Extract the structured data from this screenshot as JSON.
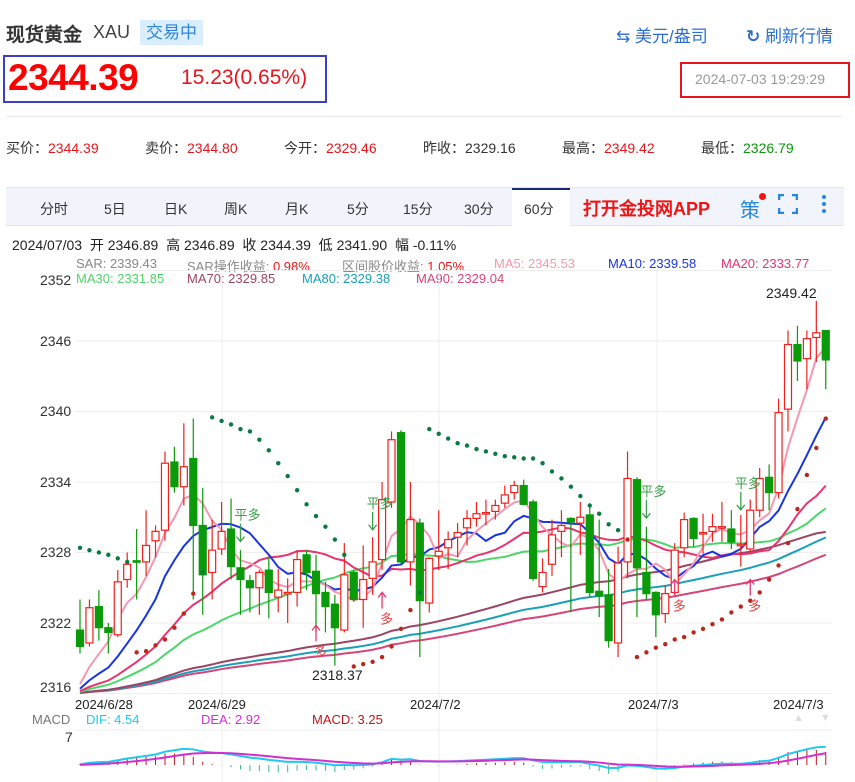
{
  "header": {
    "title": "现货黄金",
    "code": "XAU",
    "status": "交易中",
    "unit_label": "美元/盎司",
    "refresh_label": "刷新行情"
  },
  "quote": {
    "price": "2344.39",
    "change": "15.23(0.65%)",
    "timestamp": "2024-07-03 19:29:29"
  },
  "stats": [
    {
      "label": "买价：",
      "value": "2344.39",
      "color": "#e8161c"
    },
    {
      "label": "卖价：",
      "value": "2344.80",
      "color": "#e8161c"
    },
    {
      "label": "今开：",
      "value": "2329.46",
      "color": "#e8161c"
    },
    {
      "label": "昨收：",
      "value": "2329.16",
      "color": "#333333"
    },
    {
      "label": "最高：",
      "value": "2349.42",
      "color": "#e8161c"
    },
    {
      "label": "最低：",
      "value": "2326.79",
      "color": "#0a9a0a"
    }
  ],
  "tabs": [
    "分时",
    "5日",
    "日K",
    "周K",
    "月K",
    "5分",
    "15分",
    "30分",
    "60分"
  ],
  "active_tab": "60分",
  "app_link": "打开金投网APP",
  "strategy_label": "策",
  "info_line": "2024/07/03  开 2346.89  高 2346.89  收 2344.39  低 2341.90  幅 -0.11%",
  "indicators": {
    "sar": "SAR: 2339.43",
    "sar_profit_label": "SAR操作收益: ",
    "sar_profit": "0.98%",
    "range_profit_label": "区间股价收益: ",
    "range_profit": "1.05%",
    "ma5": "MA5: 2345.53",
    "ma10": "MA10: 2339.58",
    "ma20": "MA20: 2333.77",
    "ma30": "MA30: 2331.85",
    "ma70": "MA70: 2329.85",
    "ma80": "MA80: 2329.38",
    "ma90": "MA90: 2329.04"
  },
  "macd": {
    "label": "MACD",
    "dif": "DIF: 4.54",
    "dea": "DEA: 2.92",
    "macd": "MACD: 3.25",
    "tick": "7"
  },
  "colors": {
    "up": "#f0201c",
    "down": "#0a9a0a",
    "ma5": "#f598b0",
    "ma10": "#1a35e0",
    "ma20": "#e8336e",
    "ma30": "#4cd66a",
    "ma70": "#9b4466",
    "ma80": "#19a0b8",
    "ma90": "#d6457a",
    "dif": "#1ec8f0",
    "dea": "#d030d0"
  },
  "chart_data": {
    "type": "candlestick",
    "y_ticks": [
      "2352",
      "2346",
      "2340",
      "2334",
      "2328",
      "2322",
      "2316"
    ],
    "ylim": [
      2316,
      2352
    ],
    "x_labels": [
      {
        "text": "2024/6/28",
        "i": 0
      },
      {
        "text": "2024/6/29",
        "i": 14
      },
      {
        "text": "2024/7/2",
        "i": 36
      },
      {
        "text": "2024/7/3",
        "i": 59
      },
      {
        "text": "2024/7/3",
        "i": 79
      }
    ],
    "high_label": "2349.42",
    "low_label": "2318.37",
    "ohlc": [
      [
        2321.4,
        2320.0,
        2324.0,
        2319.4
      ],
      [
        2320.3,
        2323.3,
        2324.0,
        2320.0
      ],
      [
        2323.4,
        2321.6,
        2324.8,
        2320.5
      ],
      [
        2321.6,
        2321.2,
        2322.0,
        2319.4
      ],
      [
        2321.0,
        2325.5,
        2326.5,
        2320.8
      ],
      [
        2325.7,
        2327.0,
        2328.0,
        2325.0
      ],
      [
        2327.3,
        2327.2,
        2330.0,
        2324.0
      ],
      [
        2327.2,
        2328.6,
        2331.6,
        2326.0
      ],
      [
        2329.0,
        2329.8,
        2330.3,
        2327.6
      ],
      [
        2329.9,
        2335.6,
        2336.6,
        2329.0
      ],
      [
        2335.7,
        2333.6,
        2337.0,
        2333.1
      ],
      [
        2333.6,
        2335.3,
        2339.0,
        2332.0
      ],
      [
        2336.0,
        2330.3,
        2339.4,
        2324.0
      ],
      [
        2330.3,
        2326.1,
        2333.5,
        2322.7
      ],
      [
        2326.3,
        2328.2,
        2330.8,
        2324.0
      ],
      [
        2328.3,
        2329.8,
        2332.3,
        2327.8
      ],
      [
        2330.0,
        2326.8,
        2332.6,
        2325.7
      ],
      [
        2326.7,
        2325.7,
        2328.2,
        2322.7
      ],
      [
        2325.6,
        2325.0,
        2326.1,
        2322.9
      ],
      [
        2325.0,
        2326.3,
        2326.5,
        2322.7
      ],
      [
        2326.5,
        2324.6,
        2327.6,
        2322.4
      ],
      [
        2324.2,
        2324.8,
        2326.6,
        2322.9
      ],
      [
        2324.5,
        2324.6,
        2325.8,
        2322.0
      ],
      [
        2324.6,
        2327.4,
        2328.2,
        2323.4
      ],
      [
        2327.8,
        2326.3,
        2328.2,
        2324.8
      ],
      [
        2326.4,
        2324.5,
        2327.8,
        2321.2
      ],
      [
        2324.6,
        2323.4,
        2325.5,
        2321.2
      ],
      [
        2323.6,
        2321.6,
        2324.4,
        2318.37
      ],
      [
        2321.4,
        2326.1,
        2328.8,
        2321.2
      ],
      [
        2326.3,
        2324.0,
        2326.5,
        2323.8
      ],
      [
        2324.0,
        2325.7,
        2328.6,
        2321.6
      ],
      [
        2325.8,
        2327.2,
        2329.3,
        2324.4
      ],
      [
        2327.4,
        2332.5,
        2334.0,
        2326.5
      ],
      [
        2332.3,
        2337.6,
        2338.3,
        2331.8
      ],
      [
        2338.2,
        2327.2,
        2338.4,
        2327.0
      ],
      [
        2327.2,
        2330.8,
        2334.0,
        2325.2
      ],
      [
        2330.5,
        2323.9,
        2330.9,
        2319.1
      ],
      [
        2323.7,
        2327.5,
        2327.6,
        2322.9
      ],
      [
        2327.7,
        2328.1,
        2331.6,
        2326.5
      ],
      [
        2328.4,
        2329.1,
        2329.8,
        2326.6
      ],
      [
        2329.3,
        2329.7,
        2330.5,
        2327.6
      ],
      [
        2330.1,
        2330.9,
        2331.6,
        2328.6
      ],
      [
        2330.9,
        2331.3,
        2332.3,
        2330.2
      ],
      [
        2331.3,
        2331.4,
        2332.5,
        2330.3
      ],
      [
        2331.5,
        2332.0,
        2332.5,
        2330.8
      ],
      [
        2332.2,
        2332.9,
        2333.7,
        2331.8
      ],
      [
        2333.1,
        2333.7,
        2334.1,
        2332.5
      ],
      [
        2333.7,
        2332.1,
        2334.2,
        2332.0
      ],
      [
        2332.3,
        2325.8,
        2332.5,
        2325.6
      ],
      [
        2325.1,
        2326.3,
        2327.5,
        2324.6
      ],
      [
        2327.0,
        2329.5,
        2330.8,
        2326.0
      ],
      [
        2329.8,
        2330.3,
        2331.6,
        2327.6
      ],
      [
        2330.9,
        2330.6,
        2331.0,
        2322.9
      ],
      [
        2330.5,
        2331.0,
        2332.3,
        2327.8
      ],
      [
        2331.2,
        2324.6,
        2332.0,
        2324.2
      ],
      [
        2324.7,
        2324.3,
        2330.8,
        2322.5
      ],
      [
        2324.4,
        2320.5,
        2326.6,
        2319.9
      ],
      [
        2320.3,
        2327.1,
        2328.5,
        2319.1
      ],
      [
        2327.2,
        2334.3,
        2336.6,
        2325.8
      ],
      [
        2334.2,
        2326.7,
        2334.4,
        2322.5
      ],
      [
        2326.3,
        2324.5,
        2330.2,
        2324.0
      ],
      [
        2324.6,
        2322.7,
        2324.7,
        2320.8
      ],
      [
        2322.8,
        2324.5,
        2325.2,
        2322.0
      ],
      [
        2324.6,
        2328.2,
        2328.8,
        2324.4
      ],
      [
        2328.4,
        2330.8,
        2331.4,
        2327.6
      ],
      [
        2330.9,
        2329.2,
        2331.0,
        2328.5
      ],
      [
        2329.6,
        2329.7,
        2331.3,
        2327.9
      ],
      [
        2329.8,
        2330.2,
        2331.3,
        2328.9
      ],
      [
        2330.1,
        2330.2,
        2332.3,
        2328.9
      ],
      [
        2330.0,
        2328.9,
        2331.6,
        2328.3
      ],
      [
        2328.6,
        2328.7,
        2331.2,
        2326.8
      ],
      [
        2328.3,
        2331.6,
        2332.5,
        2328.0
      ],
      [
        2331.6,
        2334.3,
        2335.2,
        2331.0
      ],
      [
        2334.4,
        2333.1,
        2335.5,
        2331.6
      ],
      [
        2333.1,
        2339.9,
        2341.1,
        2332.6
      ],
      [
        2340.2,
        2345.7,
        2346.9,
        2338.3
      ],
      [
        2345.7,
        2344.3,
        2347.3,
        2342.6
      ],
      [
        2344.5,
        2346.2,
        2346.9,
        2341.9
      ],
      [
        2346.3,
        2346.7,
        2349.42,
        2344.2
      ],
      [
        2346.89,
        2344.39,
        2346.89,
        2341.9
      ]
    ],
    "sar": [
      2328.4,
      2328.2,
      2328.0,
      2327.8,
      2327.5,
      2327.2,
      2319.5,
      2319.6,
      2320.1,
      2320.6,
      2321.6,
      2322.8,
      2324.5,
      2326.3,
      2339.5,
      2339.2,
      2338.9,
      2338.5,
      2338.3,
      2337.6,
      2336.7,
      2335.6,
      2334.5,
      2333.3,
      2332.1,
      2331.1,
      2330.2,
      2329.1,
      2327.8,
      2318.3,
      2318.5,
      2318.7,
      2319.1,
      2320.0,
      2321.5,
      2323.1,
      2324.6,
      2338.5,
      2338.1,
      2337.7,
      2337.3,
      2337.1,
      2336.8,
      2336.6,
      2336.4,
      2336.2,
      2336.1,
      2336.0,
      2336.0,
      2335.6,
      2334.9,
      2334.3,
      2333.6,
      2332.8,
      2332.0,
      2331.3,
      2330.4,
      2329.9,
      2329.1,
      2319.1,
      2319.5,
      2319.9,
      2320.2,
      2320.6,
      2320.8,
      2321.2,
      2321.5,
      2321.9,
      2322.3,
      2322.9,
      2323.4,
      2323.9,
      2324.6,
      2325.7,
      2326.9,
      2328.8,
      2331.7,
      2334.6,
      2336.9,
      2339.4
    ],
    "history_base": 2316,
    "annotations": [
      {
        "text": "平多",
        "i": 17,
        "v": 2330.8,
        "kind": "close"
      },
      {
        "text": "多",
        "i": 25,
        "v": 2321.8,
        "kind": "long"
      },
      {
        "text": "平多",
        "i": 31,
        "v": 2331.8,
        "kind": "close"
      },
      {
        "text": "多",
        "i": 32,
        "v": 2324.6,
        "kind": "long"
      },
      {
        "text": "平多",
        "i": 60,
        "v": 2332.8,
        "kind": "close"
      },
      {
        "text": "多",
        "i": 63,
        "v": 2325.7,
        "kind": "long"
      },
      {
        "text": "平多",
        "i": 70,
        "v": 2333.5,
        "kind": "close"
      },
      {
        "text": "多",
        "i": 71,
        "v": 2325.7,
        "kind": "long"
      }
    ]
  }
}
